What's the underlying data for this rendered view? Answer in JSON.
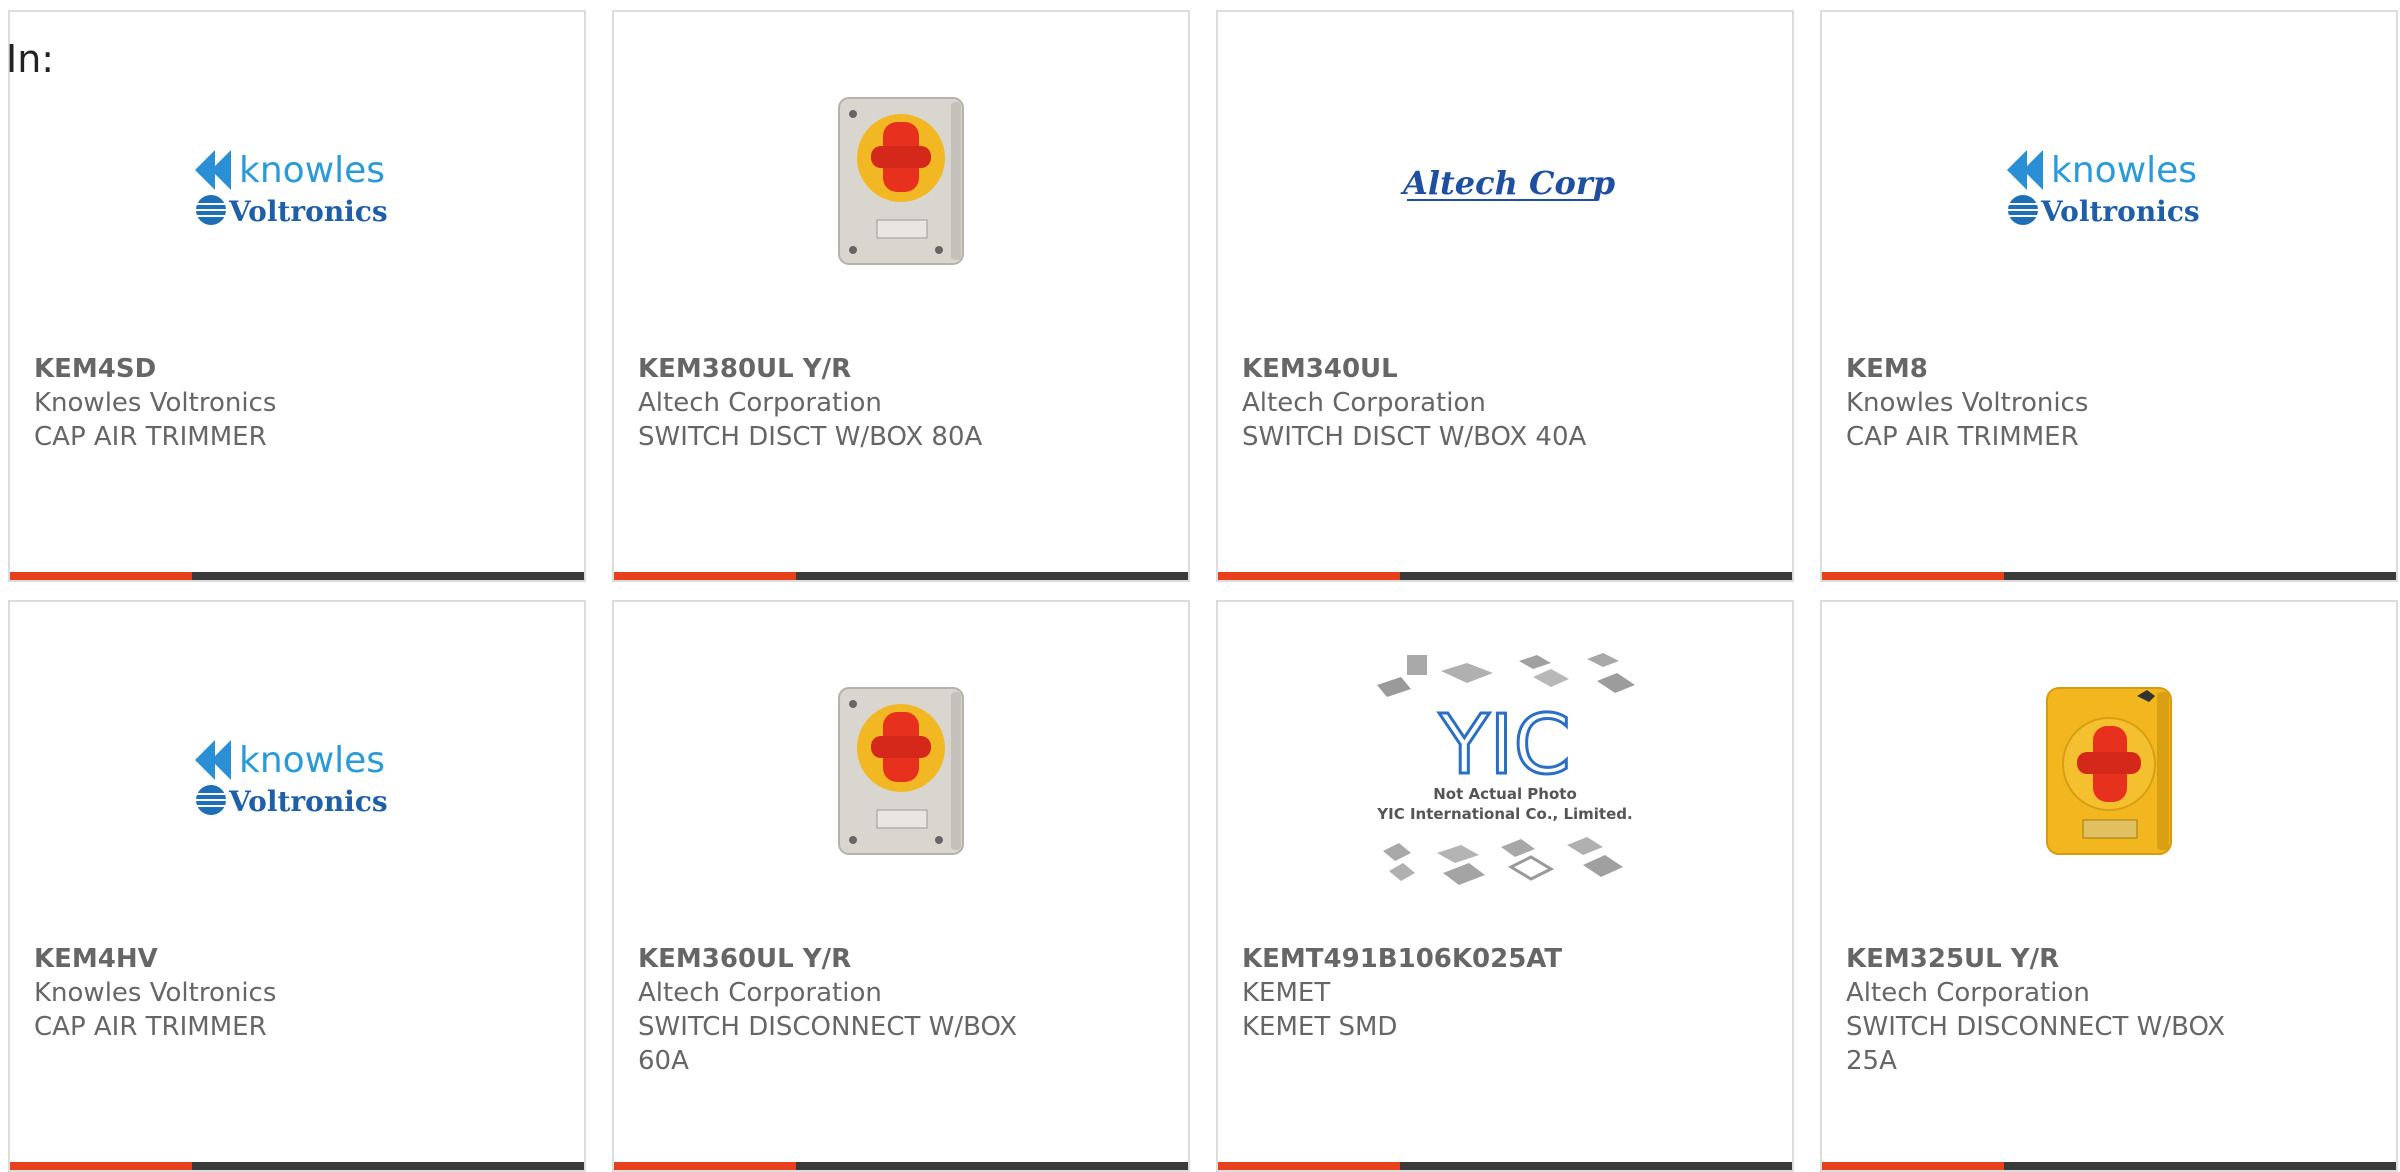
{
  "header": {
    "filter_label": "In:"
  },
  "colors": {
    "accent": "#e8401c",
    "bar": "#3a3a3a",
    "text": "#666666",
    "border": "#dcdcdc"
  },
  "logos": {
    "knowles_top": "knowles",
    "knowles_bottom": "Voltronics",
    "altech": "Altech Corp.",
    "yic_letters": "YIC",
    "yic_line1": "Not Actual Photo",
    "yic_line2": "YIC International Co., Limited."
  },
  "products": [
    {
      "part_number": "KEM4SD",
      "manufacturer": "Knowles Voltronics",
      "description": "CAP AIR TRIMMER",
      "image": "knowles-logo"
    },
    {
      "part_number": "KEM380UL Y/R",
      "manufacturer": "Altech Corporation",
      "description": "SWITCH DISCT W/BOX 80A",
      "image": "grey-switch-box"
    },
    {
      "part_number": "KEM340UL",
      "manufacturer": "Altech Corporation",
      "description": "SWITCH DISCT W/BOX 40A",
      "image": "altech-logo"
    },
    {
      "part_number": "KEM8",
      "manufacturer": "Knowles Voltronics",
      "description": "CAP AIR TRIMMER",
      "image": "knowles-logo"
    },
    {
      "part_number": "KEM4HV",
      "manufacturer": "Knowles Voltronics",
      "description": "CAP AIR TRIMMER",
      "image": "knowles-logo"
    },
    {
      "part_number": "KEM360UL Y/R",
      "manufacturer": "Altech Corporation",
      "description": "SWITCH DISCONNECT W/BOX 60A",
      "image": "grey-switch-box"
    },
    {
      "part_number": "KEMT491B106K025AT",
      "manufacturer": "KEMET",
      "description": "KEMET SMD",
      "image": "yic-placeholder"
    },
    {
      "part_number": "KEM325UL Y/R",
      "manufacturer": "Altech Corporation",
      "description": "SWITCH DISCONNECT W/BOX 25A",
      "image": "yellow-switch-box"
    }
  ]
}
